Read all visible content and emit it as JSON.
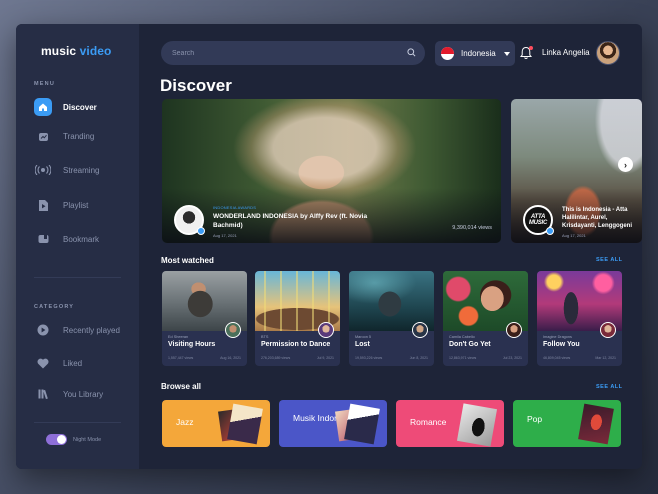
{
  "brand": {
    "name_part1": "music",
    "name_part2": " video",
    "accent_color": "#3b9cf5"
  },
  "sidebar": {
    "menu_label": "MENU",
    "menu_items": [
      {
        "label": "Discover",
        "icon": "home-icon",
        "active": true
      },
      {
        "label": "Tranding",
        "icon": "trending-icon",
        "active": false
      },
      {
        "label": "Streaming",
        "icon": "broadcast-icon",
        "active": false
      },
      {
        "label": "Playlist",
        "icon": "playlist-icon",
        "active": false
      },
      {
        "label": "Bookmark",
        "icon": "bookmark-icon",
        "active": false
      }
    ],
    "category_label": "CATEGORY",
    "category_items": [
      {
        "label": "Recently played",
        "icon": "play-circle-icon"
      },
      {
        "label": "Liked",
        "icon": "heart-icon"
      },
      {
        "label": "You Library",
        "icon": "library-icon"
      }
    ],
    "night_mode_label": "Night Mode",
    "night_mode_on": true
  },
  "header": {
    "search_placeholder": "Search",
    "country": "Indonesia",
    "user_name": "Linka Angelia"
  },
  "page_title": "Discover",
  "featured": [
    {
      "tag": "INDONESIA AWARDS",
      "title": "WONDERLAND INDONESIA by Alffy Rev (ft. Novia Bachmid)",
      "date": "Aug 17, 2021",
      "views": "9,390,014 views"
    },
    {
      "avatar_text": "ATTA MUSIC",
      "title": "This is Indonesia - Atta Halilintar, Aurel, Krisdayanti, Lenggogeni",
      "date": "Aug 17, 2021"
    }
  ],
  "most_watched": {
    "title": "Most watched",
    "see_all": "SEE ALL",
    "items": [
      {
        "artist": "Ed Sheeran",
        "title": "Visiting Hours",
        "views": "1,557,447 views",
        "date": "Aug 16, 2021"
      },
      {
        "artist": "BTS",
        "title": "Permission to Dance",
        "views": "276,203,689 views",
        "date": "Jul 9, 2021"
      },
      {
        "artist": "Maroon 5",
        "title": "Lost",
        "views": "19,593,226 views",
        "date": "Jun 8, 2021"
      },
      {
        "artist": "Camila Cabello",
        "title": "Don't Go Yet",
        "views": "12,863,971 views",
        "date": "Jul 23, 2021"
      },
      {
        "artist": "Imagine Dragons",
        "title": "Follow You",
        "views": "46,809,045 views",
        "date": "Mar 12, 2021"
      }
    ]
  },
  "browse_all": {
    "title": "Browse all",
    "see_all": "SEE ALL",
    "genres": [
      {
        "label": "Jazz",
        "color": "#f4a73a"
      },
      {
        "label": "Musik Indonesia",
        "color": "#4b56c8"
      },
      {
        "label": "Romance",
        "color": "#ee4b78"
      },
      {
        "label": "Pop",
        "color": "#2eae4a"
      }
    ]
  }
}
